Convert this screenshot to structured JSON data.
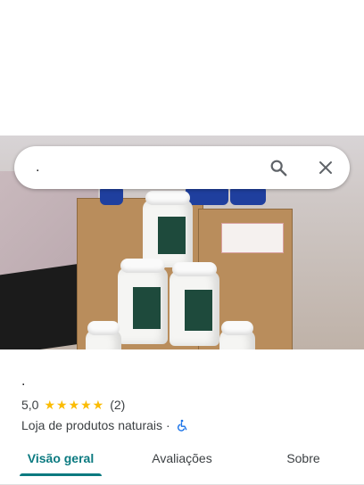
{
  "search": {
    "query": "."
  },
  "place": {
    "name": ".",
    "rating": "5,0",
    "stars": "★★★★★",
    "review_count": "(2)",
    "category": "Loja de produtos naturais",
    "separator": "·"
  },
  "tabs": [
    {
      "label": "Visão geral",
      "active": true
    },
    {
      "label": "Avaliações",
      "active": false
    },
    {
      "label": "Sobre",
      "active": false
    }
  ],
  "colors": {
    "accent": "#0b7a80",
    "star": "#fbbc04",
    "accessibility": "#1a73e8"
  },
  "icons": [
    "search-icon",
    "close-icon",
    "wheelchair-icon"
  ]
}
